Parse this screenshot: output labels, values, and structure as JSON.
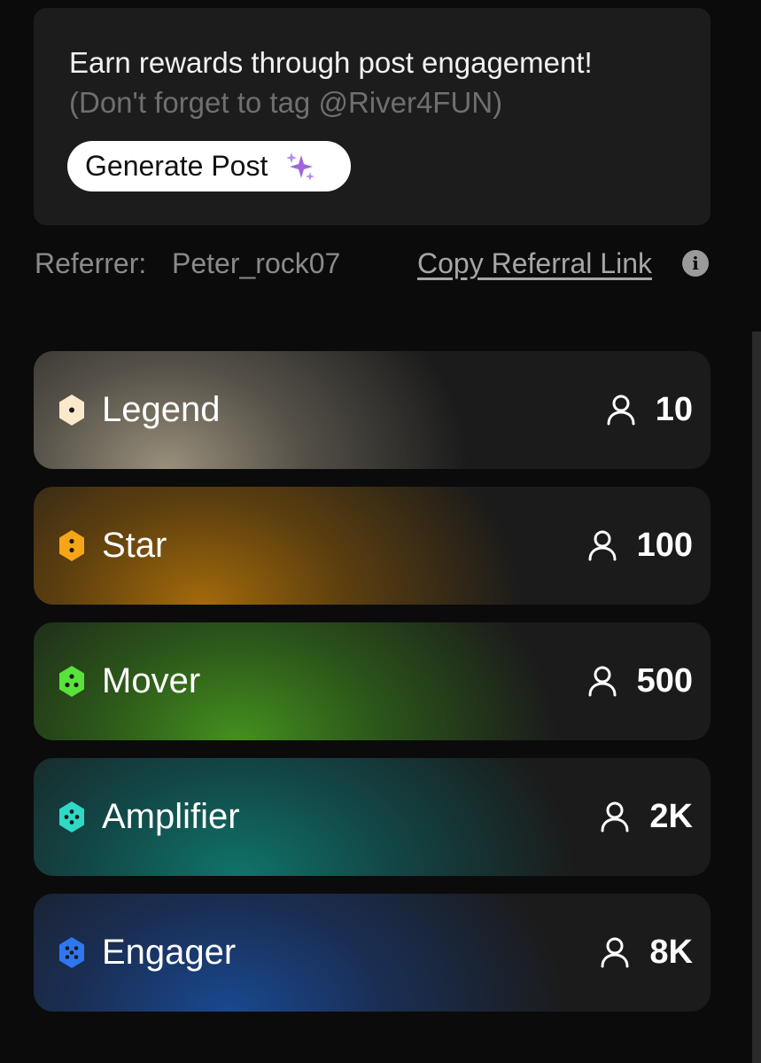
{
  "promo": {
    "line1": "Earn rewards through post engagement!",
    "line2": "(Don't forget to tag @River4FUN)",
    "button_label": "Generate Post",
    "button_icon": "sparkle-icon",
    "sparkle_color": "#a066e0"
  },
  "referral": {
    "label": "Referrer:",
    "username": "Peter_rock07",
    "copy_link_label": "Copy Referral Link",
    "info_icon_glyph": "i"
  },
  "tiers": [
    {
      "name": "Legend",
      "count": "10",
      "color": "#fbe9cc"
    },
    {
      "name": "Star",
      "count": "100",
      "color": "#f5a517"
    },
    {
      "name": "Mover",
      "count": "500",
      "color": "#58e33a"
    },
    {
      "name": "Amplifier",
      "count": "2K",
      "color": "#2fd9c6"
    },
    {
      "name": "Engager",
      "count": "8K",
      "color": "#2f76f0"
    }
  ]
}
